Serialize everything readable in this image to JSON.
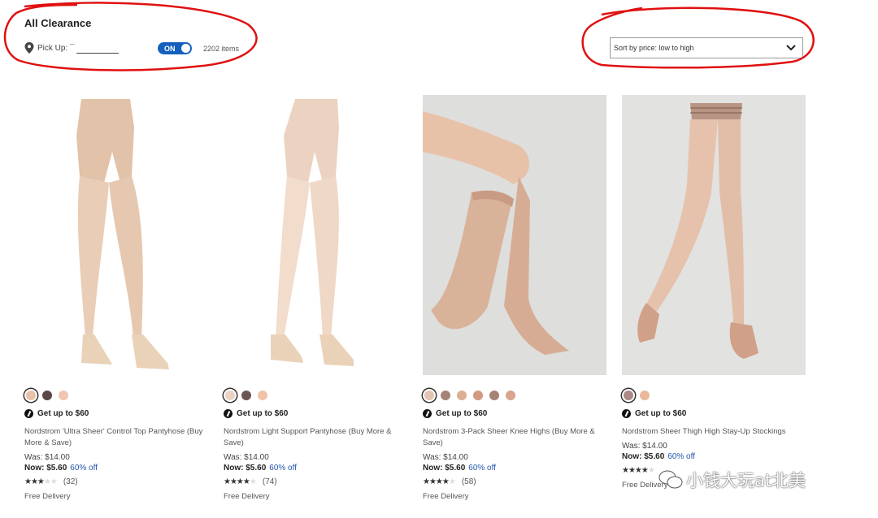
{
  "header": {
    "title": "All Clearance",
    "pickup_label": "Pick Up: ¯",
    "toggle_label": "ON",
    "item_count": "2202 items",
    "sort_label": "Sort by price: low to high"
  },
  "products": [
    {
      "name": "Nordstrom 'Ultra Sheer' Control Top Pantyhose (Buy More & Save)",
      "promo": "Get up to $60",
      "was": "Was: $14.00",
      "now_label": "Now:",
      "now_price": "$5.60",
      "discount": "60% off",
      "rating": 3,
      "review_count": "(32)",
      "delivery": "Free Delivery",
      "swatches": [
        "#e8c2a8",
        "#5a4848",
        "#f0c6b0"
      ]
    },
    {
      "name": "Nordstrom Light Support Pantyhose (Buy More & Save)",
      "promo": "Get up to $60",
      "was": "Was: $14.00",
      "now_label": "Now:",
      "now_price": "$5.60",
      "discount": "60% off",
      "rating": 4,
      "review_count": "(74)",
      "delivery": "Free Delivery",
      "swatches": [
        "#ecd3c2",
        "#6b5654",
        "#f0c2a6"
      ]
    },
    {
      "name": "Nordstrom 3-Pack Sheer Knee Highs (Buy More & Save)",
      "promo": "Get up to $60",
      "was": "Was: $14.00",
      "now_label": "Now:",
      "now_price": "$5.60",
      "discount": "60% off",
      "rating": 4,
      "review_count": "(58)",
      "delivery": "Free Delivery",
      "swatches": [
        "#e4c4b2",
        "#a48478",
        "#dcae92",
        "#d29882",
        "#a68276",
        "#d8a490"
      ]
    },
    {
      "name": "Nordstrom Sheer Thigh High Stay-Up Stockings",
      "promo": "Get up to $60",
      "was": "Was: $14.00",
      "now_label": "Now:",
      "now_price": "$5.60",
      "discount": "60% off",
      "rating": 4,
      "review_count": "",
      "delivery": "Free Delivery",
      "swatches": [
        "#a98a84",
        "#eab99c"
      ]
    }
  ],
  "watermark": {
    "text": "小钱大玩at北美"
  },
  "colors": {
    "accent": "#1560bd",
    "annotation": "#e01010",
    "link": "#2255aa"
  }
}
